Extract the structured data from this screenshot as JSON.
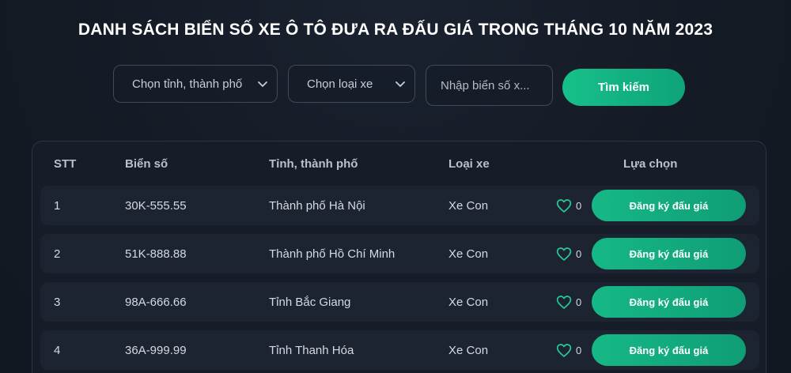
{
  "page": {
    "title": "DANH SÁCH BIỂN SỐ XE Ô TÔ ĐƯA RA ĐẤU GIÁ TRONG THÁNG 10 NĂM 2023"
  },
  "filters": {
    "province_select": {
      "value": "Chọn tỉnh, thành phố",
      "icon": "chevron-down-icon"
    },
    "type_select": {
      "value": "Chọn loại xe",
      "icon": "chevron-down-icon"
    },
    "plate_input": {
      "placeholder": "Nhập biển số x...",
      "value": ""
    },
    "search_button": "Tìm kiếm"
  },
  "table": {
    "columns": {
      "stt": "STT",
      "plate": "Biển số",
      "province": "Tỉnh, thành phố",
      "type": "Loại xe",
      "options": "Lựa chọn"
    },
    "rows": [
      {
        "stt": "1",
        "plate": "30K-555.55",
        "province": "Thành phố Hà Nội",
        "type": "Xe Con",
        "likes": "0",
        "action": "Đăng ký đấu giá"
      },
      {
        "stt": "2",
        "plate": "51K-888.88",
        "province": "Thành phố Hồ Chí Minh",
        "type": "Xe Con",
        "likes": "0",
        "action": "Đăng ký đấu giá"
      },
      {
        "stt": "3",
        "plate": "98A-666.66",
        "province": "Tỉnh Bắc Giang",
        "type": "Xe Con",
        "likes": "0",
        "action": "Đăng ký đấu giá"
      },
      {
        "stt": "4",
        "plate": "36A-999.99",
        "province": "Tỉnh Thanh Hóa",
        "type": "Xe Con",
        "likes": "0",
        "action": "Đăng ký đấu giá"
      }
    ]
  },
  "colors": {
    "background": "#141a24",
    "accent": "#14b385",
    "row_background": "#1c2431",
    "heart_icon": "#27c99a"
  }
}
